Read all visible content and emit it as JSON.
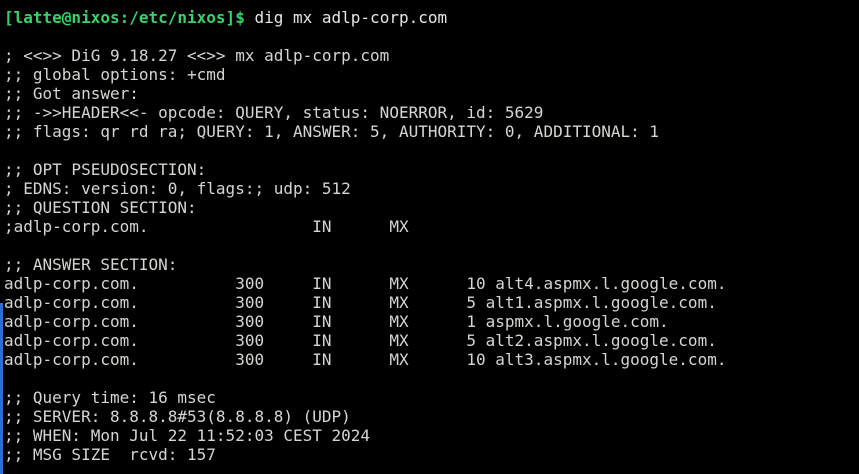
{
  "terminal": {
    "prompt": "[latte@nixos:/etc/nixos]$",
    "command": " dig mx adlp-corp.com",
    "header_lines": [
      "; <<>> DiG 9.18.27 <<>> mx adlp-corp.com",
      ";; global options: +cmd",
      ";; Got answer:",
      ";; ->>HEADER<<- opcode: QUERY, status: NOERROR, id: 5629",
      ";; flags: qr rd ra; QUERY: 1, ANSWER: 5, AUTHORITY: 0, ADDITIONAL: 1"
    ],
    "opt_lines": [
      ";; OPT PSEUDOSECTION:",
      "; EDNS: version: 0, flags:; udp: 512",
      ";; QUESTION SECTION:",
      ";adlp-corp.com.                 IN      MX"
    ],
    "answer_lines": [
      ";; ANSWER SECTION:",
      "adlp-corp.com.          300     IN      MX      10 alt4.aspmx.l.google.com.",
      "adlp-corp.com.          300     IN      MX      5 alt1.aspmx.l.google.com.",
      "adlp-corp.com.          300     IN      MX      1 aspmx.l.google.com.",
      "adlp-corp.com.          300     IN      MX      5 alt2.aspmx.l.google.com.",
      "adlp-corp.com.          300     IN      MX      10 alt3.aspmx.l.google.com."
    ],
    "footer_lines": [
      ";; Query time: 16 msec",
      ";; SERVER: 8.8.8.8#53(8.8.8.8) (UDP)",
      ";; WHEN: Mon Jul 22 11:52:03 CEST 2024",
      ";; MSG SIZE  rcvd: 157"
    ]
  }
}
